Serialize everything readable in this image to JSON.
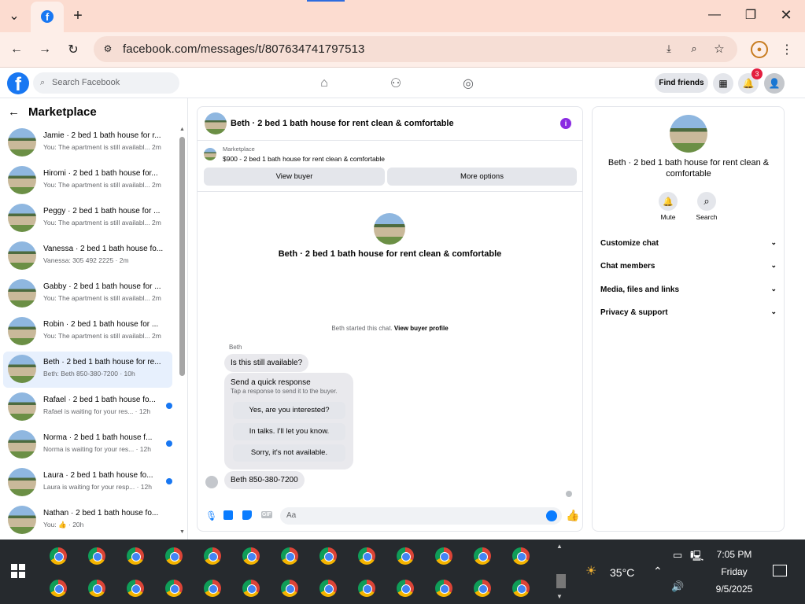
{
  "browser": {
    "url": "facebook.com/messages/t/807634741797513"
  },
  "facebook": {
    "search_placeholder": "Search Facebook",
    "find_friends": "Find friends",
    "notification_count": "3"
  },
  "sidebar": {
    "title": "Marketplace",
    "conversations": [
      {
        "name": "Jamie · 2 bed 1 bath house for r...",
        "preview": "You: The apartment is still availabl... 2m",
        "unread": false,
        "active": false
      },
      {
        "name": "Hiromi · 2 bed 1 bath house for...",
        "preview": "You: The apartment is still availabl... 2m",
        "unread": false,
        "active": false
      },
      {
        "name": "Peggy · 2 bed 1 bath house for ...",
        "preview": "You: The apartment is still availabl... 2m",
        "unread": false,
        "active": false
      },
      {
        "name": "Vanessa · 2 bed 1 bath house fo...",
        "preview": "Vanessa: 305 492 2225 · 2m",
        "unread": false,
        "active": false
      },
      {
        "name": "Gabby · 2 bed 1 bath house for ...",
        "preview": "You: The apartment is still availabl... 2m",
        "unread": false,
        "active": false
      },
      {
        "name": "Robin · 2 bed 1 bath house for ...",
        "preview": "You: The apartment is still availabl... 2m",
        "unread": false,
        "active": false
      },
      {
        "name": "Beth · 2 bed 1 bath house for re...",
        "preview": "Beth: Beth 850-380-7200 · 10h",
        "unread": false,
        "active": true
      },
      {
        "name": "Rafael · 2 bed 1 bath house fo...",
        "preview": "Rafael is waiting for your res... · 12h",
        "unread": true,
        "active": false
      },
      {
        "name": "Norma · 2 bed 1 bath house f...",
        "preview": "Norma is waiting for your res... · 12h",
        "unread": true,
        "active": false
      },
      {
        "name": "Laura · 2 bed 1 bath house fo...",
        "preview": "Laura is waiting for your resp... · 12h",
        "unread": true,
        "active": false
      },
      {
        "name": "Nathan · 2 bed 1 bath house fo...",
        "preview": "You: 👍 · 20h",
        "unread": false,
        "active": false
      }
    ]
  },
  "chat": {
    "title": "Beth · 2 bed 1 bath house for rent clean & comfortable",
    "marketplace_label": "Marketplace",
    "listing": "$900 - 2 bed 1 bath house for rent clean & comfortable",
    "view_buyer": "View buyer",
    "more_options": "More options",
    "profile_title": "Beth · 2 bed 1 bath house for rent clean & comfortable",
    "started_text": "Beth started this chat.",
    "view_buyer_profile": "View buyer profile",
    "sender_label": "Beth",
    "message_1": "Is this still available?",
    "quick_title": "Send a quick response",
    "quick_sub": "Tap a response to send it to the buyer.",
    "quick_1": "Yes, are you interested?",
    "quick_2": "In talks. I'll let you know.",
    "quick_3": "Sorry, it's not available.",
    "message_2": "Beth 850-380-7200",
    "input_placeholder": "Aa"
  },
  "details": {
    "title": "Beth · 2 bed 1 bath house for rent clean & comfortable",
    "mute": "Mute",
    "search": "Search",
    "rows": [
      "Customize chat",
      "Chat members",
      "Media, files and links",
      "Privacy & support"
    ]
  },
  "taskbar": {
    "temperature": "35°C",
    "time": "7:05 PM",
    "day": "Friday",
    "date": "9/5/2025"
  }
}
